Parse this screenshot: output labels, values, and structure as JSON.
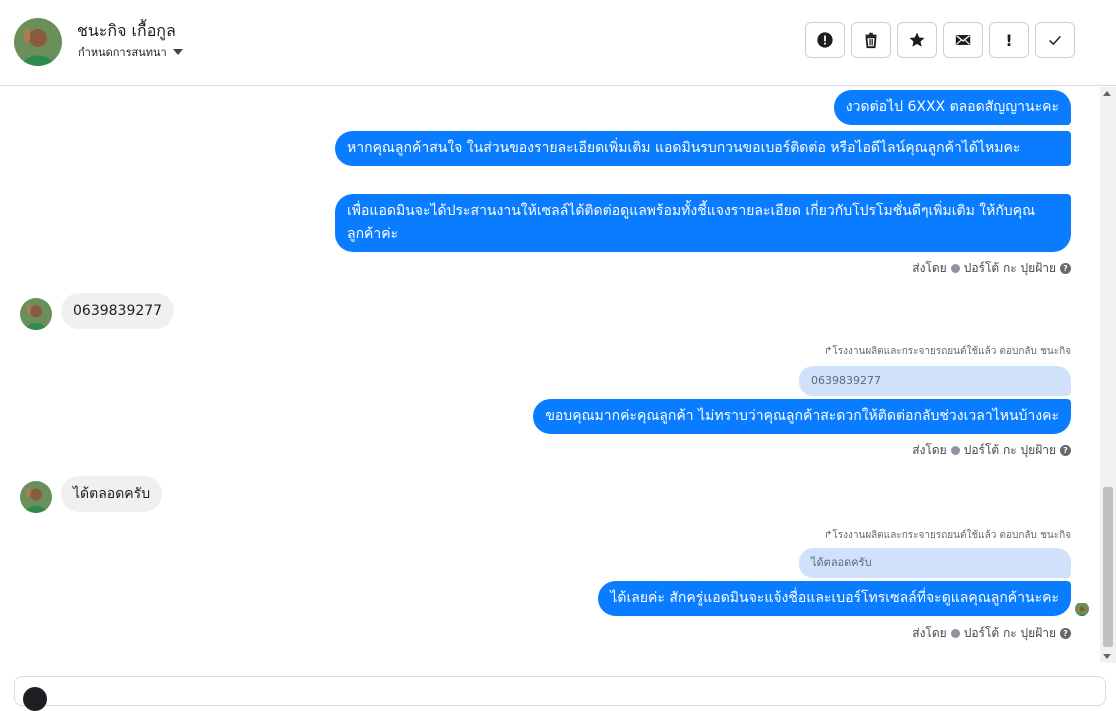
{
  "header": {
    "name": "ชนะกิจ เกื้อกูล",
    "subtitle": "กำหนดการสนทนา"
  },
  "toolbar": {
    "buttons": [
      {
        "icon": "alert-circle-icon",
        "label": "!"
      },
      {
        "icon": "trash-icon"
      },
      {
        "icon": "star-icon"
      },
      {
        "icon": "envelope-icon"
      },
      {
        "icon": "exclamation-icon",
        "label": "!"
      },
      {
        "icon": "check-icon"
      }
    ]
  },
  "messages": {
    "out1": "งวดต่อไป 6XXX ตลอดสัญญานะคะ",
    "out2": "หากคุณลูกค้าสนใจ ในส่วนของรายละเอียดเพิ่มเติม แอดมินรบกวนขอเบอร์ติดต่อ หรือไอดีไลน์คุณลูกค้าได้ไหมคะ",
    "out3": "เพื่อแอดมินจะได้ประสานงานให้เซลล์ได้ติดต่อดูแลพร้อมทั้งชี้แจงรายละเอียด เกี่ยวกับโปรโมชั่นดีๆเพิ่มเติม ให้กับคุณลูกค้าค่ะ",
    "sent_by_1": "ส่งโดย",
    "sender_1": "ปอร์โต้ กะ ปุยฝ้าย",
    "in1": "0639839277",
    "reply_note_1": "โรงงานผลิตและกระจายรถยนต์ใช้แล้ว ตอบกลับ ชนะกิจ",
    "quote_1": "0639839277",
    "out4": "ขอบคุณมากค่ะคุณลูกค้า ไม่ทราบว่าคุณลูกค้าสะดวกให้ติดต่อกลับช่วงเวลาไหนบ้างคะ",
    "sent_by_2": "ส่งโดย",
    "sender_2": "ปอร์โต้ กะ ปุยฝ้าย",
    "in2": "ได้ตลอดครับ",
    "reply_note_2": "โรงงานผลิตและกระจายรถยนต์ใช้แล้ว ตอบกลับ ชนะกิจ",
    "quote_2": "ได้ตลอดครับ",
    "out5": "ได้เลยค่ะ สักครู่แอดมินจะแจ้งชื่อและเบอร์โทรเซลล์ที่จะดูแลคุณลูกค้านะคะ",
    "sent_by_3": "ส่งโดย",
    "sender_3": "ปอร์โต้ กะ ปุยฝ้าย"
  },
  "colors": {
    "outgoing_bubble": "#0a7cff",
    "incoming_bubble": "#f0f0f0",
    "quote_bubble": "#cfe1fb"
  }
}
